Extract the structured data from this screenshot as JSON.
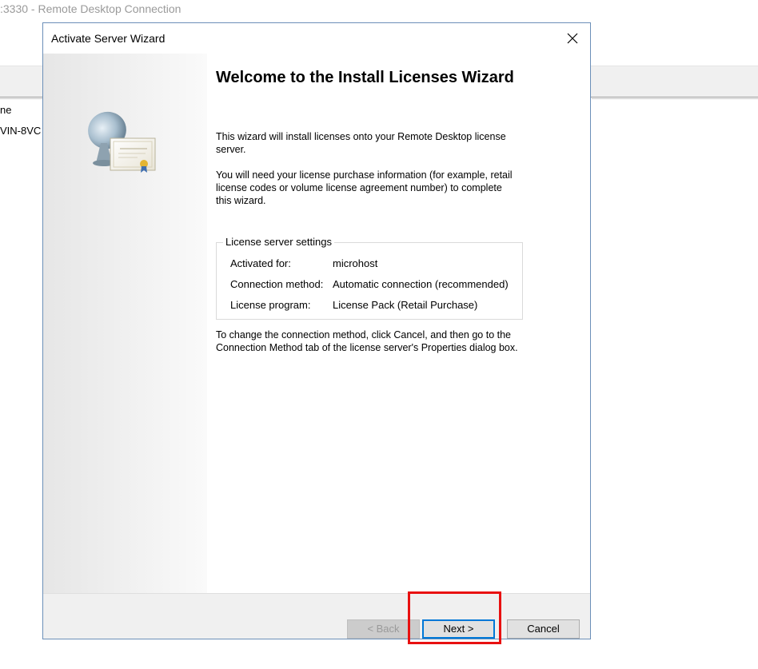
{
  "remote_window": {
    "title": ":3330 - Remote Desktop Connection",
    "bg_text_1": "ne",
    "bg_text_2": "VIN-8VC"
  },
  "dialog": {
    "title": "Activate Server Wizard",
    "heading": "Welcome to the Install Licenses Wizard",
    "intro": "This wizard will install licenses onto your Remote Desktop license server.",
    "info": "You will need your license purchase information (for example, retail license codes or volume license agreement number) to complete this wizard.",
    "group": {
      "label": "License server settings",
      "rows": [
        {
          "label": "Activated for:",
          "value": "microhost"
        },
        {
          "label": "Connection method:",
          "value": "Automatic connection (recommended)"
        },
        {
          "label": "License program:",
          "value": "License Pack (Retail Purchase)"
        }
      ]
    },
    "note": "To change the connection method, click Cancel, and then go to the Connection Method tab of the license server's Properties dialog box.",
    "buttons": {
      "back": "< Back",
      "next": "Next >",
      "cancel": "Cancel"
    }
  },
  "icons": {
    "close": "close-icon",
    "wizard": "license-certificate-icon"
  },
  "colors": {
    "highlight": "#e81010",
    "focus_border": "#0078d7",
    "dialog_border": "#6b8fb8"
  }
}
